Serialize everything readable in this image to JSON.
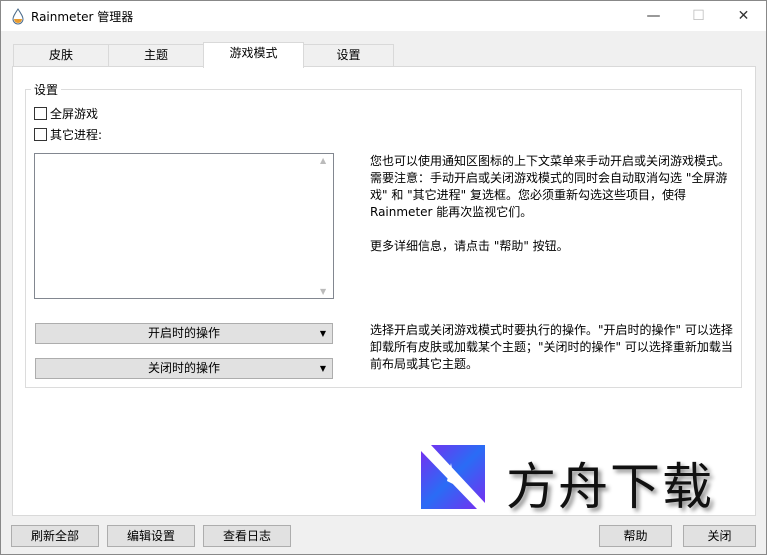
{
  "window": {
    "title": "Rainmeter 管理器",
    "minimize": "—",
    "maximize": "☐",
    "close": "✕"
  },
  "tabs": [
    {
      "label": "皮肤"
    },
    {
      "label": "主题"
    },
    {
      "label": "游戏模式"
    },
    {
      "label": "设置"
    }
  ],
  "group": {
    "label": "设置",
    "fullscreen_label": "全屏游戏",
    "fullscreen_checked": false,
    "process_label": "其它进程:",
    "process_checked": false
  },
  "info_text": [
    "您也可以使用通知区图标的上下文菜单来手动开启或关闭游戏模式。",
    "需要注意：手动开启或关闭游戏模式的同时会自动取消勾选 \"全屏游",
    "戏\" 和 \"其它进程\" 复选框。您必须重新勾选这些项目，使得",
    "Rainmeter 能再次监视它们。",
    "",
    "更多详细信息，请点击 \"帮助\" 按钮。"
  ],
  "actions": {
    "on_start": "开启时的操作",
    "on_stop": "关闭时的操作"
  },
  "actions_text": [
    "选择开启或关闭游戏模式时要执行的操作。\"开启时的操作\" 可以选择",
    "卸载所有皮肤或加载某个主题；\"关闭时的操作\" 可以选择重新加载当",
    "前布局或其它主题。"
  ],
  "buttons": {
    "refresh_all": "刷新全部",
    "edit_settings": "编辑设置",
    "view_log": "查看日志",
    "help": "帮助",
    "close": "关闭"
  },
  "watermark": {
    "text": "方舟下载"
  }
}
